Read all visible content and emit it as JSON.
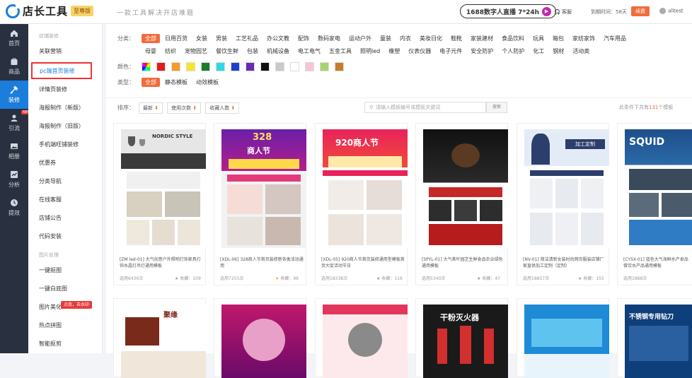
{
  "header": {
    "app_name": "店长工具",
    "edition_badge": "至尊版",
    "slogan": "一款工具解决开店难题",
    "live_text": "1688数字人直播 7*24h",
    "service": "客服",
    "expiry": "到期时间：58天",
    "renew_label": "续费",
    "username": "alitest"
  },
  "leftnav": [
    {
      "label": "首页",
      "icon": "home-icon"
    },
    {
      "label": "商品",
      "icon": "goods-icon"
    },
    {
      "label": "装修",
      "icon": "decorate-icon",
      "active": true
    },
    {
      "label": "引流",
      "icon": "traffic-icon",
      "tag": "NEW"
    },
    {
      "label": "相册",
      "icon": "album-icon"
    },
    {
      "label": "分析",
      "icon": "chart-icon"
    },
    {
      "label": "提效",
      "icon": "efficiency-icon"
    }
  ],
  "subnav": {
    "group1": "店铺装修",
    "items1": [
      "关联营销",
      "pc端首页装修",
      "详情页装修",
      "海报制作（新版）",
      "海报制作（旧版）",
      "手机端旺铺装修",
      "优惠券",
      "分类导航",
      "在线客服",
      "店铺公告",
      "代码安装"
    ],
    "group2": "图片处理",
    "items2": [
      "一键抠图",
      "一键白底图",
      "图片美化",
      "热点拼图",
      "智能抠剪"
    ],
    "watermark_tip": "点我，去水印"
  },
  "filters": {
    "category_label": "分类：",
    "row1": [
      "全部",
      "日用百货",
      "女装",
      "男装",
      "工艺礼品",
      "办公文教",
      "配饰",
      "数码家电",
      "运动户外",
      "童装",
      "内衣",
      "美妆日化",
      "鞋靴",
      "家装建材",
      "食品饮料",
      "玩具",
      "箱包",
      "家纺家饰",
      "汽车用品"
    ],
    "row2": [
      "母婴",
      "纺织",
      "宠物园艺",
      "餐饮生鲜",
      "包装",
      "机械设备",
      "电工电气",
      "五金工具",
      "照明led",
      "橡塑",
      "仪表仪器",
      "电子元件",
      "安全防护",
      "个人防护",
      "化工",
      "钢材",
      "活动类"
    ],
    "color_label": "颜色：",
    "colors": [
      "#e3e3e3",
      "#e31b1b",
      "#f39b2c",
      "#f5e62a",
      "#1a7d2b",
      "#2ed7e6",
      "#1a3fd1",
      "#6a2bb3",
      "#111111",
      "#c9c9c9",
      "#ffffff",
      "#f5c6d2",
      "#a7d36b",
      "#c77a2a"
    ],
    "type_label": "类型：",
    "types": [
      "全部",
      "静态模板",
      "动效模板"
    ]
  },
  "sort": {
    "label": "排序：",
    "buttons": [
      "最新",
      "使用次数",
      "收藏人数"
    ],
    "search_placeholder": "请输入模板编号或模板关键词",
    "search_btn": "搜索",
    "count_prefix": "此条件下共有",
    "count": "131",
    "count_suffix": "个模板"
  },
  "cards": [
    {
      "title": "[ZM led-01] 大气创意户外照明灯饰家具灯饰水晶灯吊灯通用模板",
      "uses": "选用6436次",
      "fav": "收藏：109",
      "gold": false
    },
    {
      "title": "[XDL-06] 328商人节首页装修新各类活动通用",
      "uses": "选用7255次",
      "fav": "收藏：96",
      "gold": true
    },
    {
      "title": "[XDL-05] 920商人节首页装修通用型模板首页大促活动节日",
      "uses": "选用18338次",
      "fav": "收藏：116",
      "gold": false
    },
    {
      "title": "[SPYL-01] 大气茶叶园艺生鲜食品农业绿色通用模板",
      "uses": "选用5340次",
      "fav": "收藏：47",
      "gold": false
    },
    {
      "title": "[NV-01] 简洁清新女装时尚网页服装店铺厂家直供加工定制（定制）",
      "uses": "选用18857次",
      "fav": "收藏：155",
      "gold": false
    },
    {
      "title": "[CYSX-01] 蓝色大气海鲜水产食品餐饮水产品通用模板",
      "uses": "选用1888次",
      "fav": "收藏：",
      "gold": false
    }
  ],
  "thumb_texts": {
    "nordic": "NORDIC STYLE",
    "t328": "328",
    "merchant": "商人节",
    "t920": "920商人节",
    "custom": "加工定制",
    "squid": "SQUID",
    "juyuan": "聚缘",
    "extinguisher": "干粉灭火器",
    "steel": "不锈钢专用钻刀"
  }
}
